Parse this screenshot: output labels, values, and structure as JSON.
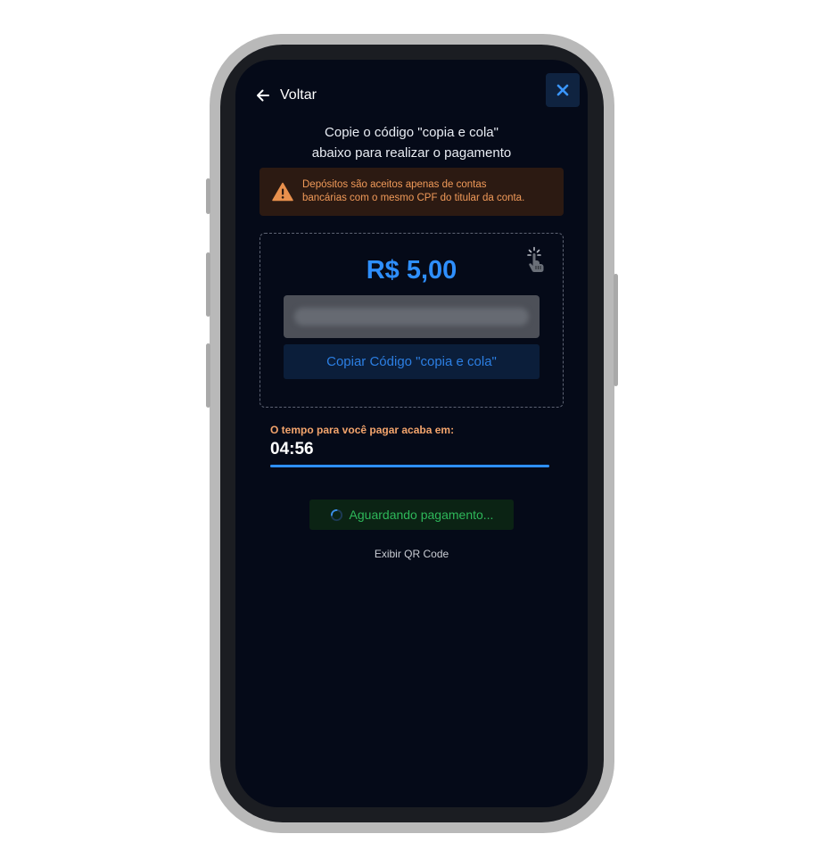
{
  "header": {
    "back_label": "Voltar",
    "back_icon": "arrow-left-icon",
    "close_icon": "close-icon"
  },
  "instructions": {
    "line1": "Copie o código \"copia e cola\"",
    "line2": "abaixo para realizar o pagamento"
  },
  "warning": {
    "icon": "warning-triangle-icon",
    "line1": "Depósitos são aceitos apenas de contas",
    "line2": "bancárias com o mesmo CPF do titular da conta."
  },
  "payment": {
    "amount": "R$ 5,00",
    "hand_icon": "tap-hand-icon",
    "code_value": "",
    "copy_button_label": "Copiar Código \"copia e cola\""
  },
  "timer": {
    "label": "O tempo para você pagar acaba em:",
    "value": "04:56",
    "progress": 1.0
  },
  "status": {
    "icon": "loading-spinner-icon",
    "label": "Aguardando pagamento..."
  },
  "qr_link_label": "Exibir QR Code",
  "colors": {
    "accent_blue": "#2e8fff",
    "warning_orange": "#f19a59",
    "success_green": "#2eb85a",
    "screen_background": "#050a18"
  }
}
